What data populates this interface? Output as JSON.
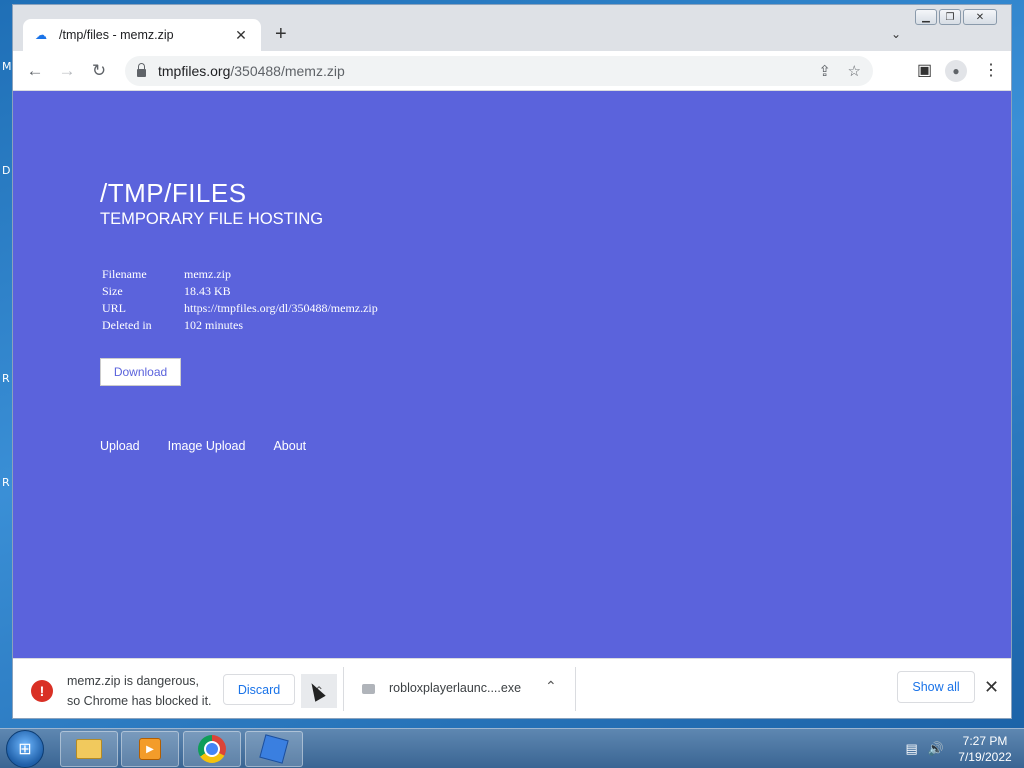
{
  "desktop": {
    "icon_letters": [
      "M",
      "D",
      "R",
      "R"
    ]
  },
  "browser": {
    "tab_title": "/tmp/files - memz.zip",
    "tab_favicon": "cloud-upload-icon",
    "url_host": "tmpfiles.org",
    "url_path": "/350488/memz.zip"
  },
  "page": {
    "title": "/TMP/FILES",
    "subtitle": "TEMPORARY FILE HOSTING",
    "info": [
      {
        "key": "Filename",
        "value": "memz.zip"
      },
      {
        "key": "Size",
        "value": "18.43 KB"
      },
      {
        "key": "URL",
        "value": "https://tmpfiles.org/dl/350488/memz.zip"
      },
      {
        "key": "Deleted in",
        "value": "102 minutes"
      }
    ],
    "download_label": "Download",
    "footer_links": [
      "Upload",
      "Image Upload",
      "About"
    ],
    "background_color": "#5b63dc"
  },
  "downloads": {
    "warning_line1": "memz.zip is dangerous,",
    "warning_line2": "so Chrome has blocked it.",
    "discard_label": "Discard",
    "file_name": "robloxplayerlaunc....exe",
    "show_all_label": "Show all"
  },
  "taskbar": {
    "time": "7:27 PM",
    "date": "7/19/2022"
  }
}
